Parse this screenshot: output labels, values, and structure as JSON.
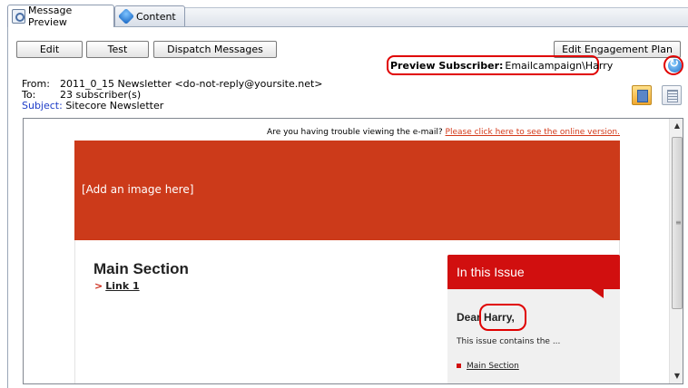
{
  "tabs": [
    {
      "label": "Message Preview",
      "icon": "preview-icon"
    },
    {
      "label": "Content",
      "icon": "content-icon"
    }
  ],
  "toolbar": {
    "edit_label": "Edit",
    "test_label": "Test",
    "dispatch_label": "Dispatch Messages",
    "engagement_label": "Edit Engagement Plan"
  },
  "preview_subscriber": {
    "label": "Preview Subscriber:",
    "value": "Emailcampaign\\Harry"
  },
  "message": {
    "from_key": "From:",
    "from_value": "2011_0_15 Newsletter <do-not-reply@yoursite.net>",
    "to_key": "To:",
    "to_value": "23 subscriber(s)",
    "subject_key": "Subject:",
    "subject_value": "Sitecore Newsletter"
  },
  "email": {
    "trouble_text": "Are you having trouble viewing the e-mail? ",
    "trouble_link": "Please click here to see the online version.",
    "banner_text": "[Add an image here]",
    "main_title": "Main Section",
    "link1_arrow": ">",
    "link1": "Link 1",
    "issue_title": "In this Issue",
    "dear_prefix": "Dear ",
    "dear_name": "Harry,",
    "issue_desc": "This issue contains the ...",
    "issue_link": "Main Section"
  },
  "colors": {
    "banner": "#cc3a1a",
    "issue_header": "#d10f0f",
    "highlight": "#e00000",
    "subject_key": "#1e3dc8"
  }
}
